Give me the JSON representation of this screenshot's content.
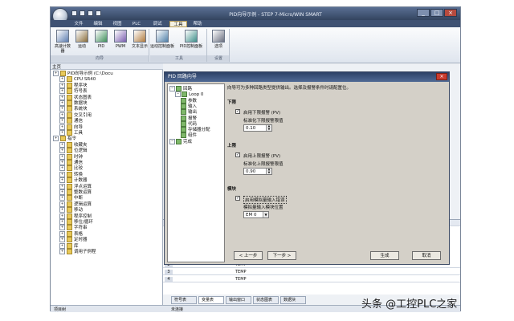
{
  "app": {
    "title": "PID向导示例 - STEP 7-Micro/WIN SMART",
    "menus": [
      "文件",
      "编辑",
      "视图",
      "PLC",
      "调试",
      "工具",
      "帮助"
    ],
    "active_menu": "工具",
    "ribbon_buttons": [
      "高速计数器",
      "运动",
      "PID",
      "PWM",
      "文本显示",
      "运动控制面板",
      "PID控制面板",
      "选项"
    ],
    "ribbon_groups": [
      "向导",
      "工具",
      "设置"
    ]
  },
  "tree": {
    "header": "主页",
    "items": [
      {
        "label": "PID向导示例 (C:\\Docu",
        "indent": 0,
        "icon": "project-icon"
      },
      {
        "label": "CPU SR40",
        "indent": 1,
        "icon": "cpu-icon"
      },
      {
        "label": "程序块",
        "indent": 1,
        "icon": "folder-icon"
      },
      {
        "label": "符号表",
        "indent": 1,
        "icon": "folder-icon"
      },
      {
        "label": "状态图表",
        "indent": 1,
        "icon": "folder-icon"
      },
      {
        "label": "数据块",
        "indent": 1,
        "icon": "folder-icon"
      },
      {
        "label": "系统块",
        "indent": 1,
        "icon": "folder-icon"
      },
      {
        "label": "交叉引用",
        "indent": 1,
        "icon": "folder-icon"
      },
      {
        "label": "通信",
        "indent": 1,
        "icon": "folder-icon"
      },
      {
        "label": "向导",
        "indent": 1,
        "icon": "folder-icon"
      },
      {
        "label": "工具",
        "indent": 1,
        "icon": "folder-icon"
      },
      {
        "label": "指令",
        "indent": 0,
        "icon": "folder-icon"
      },
      {
        "label": "收藏夹",
        "indent": 1,
        "icon": "folder-icon"
      },
      {
        "label": "位逻辑",
        "indent": 1,
        "icon": "folder-icon"
      },
      {
        "label": "时钟",
        "indent": 1,
        "icon": "folder-icon"
      },
      {
        "label": "通信",
        "indent": 1,
        "icon": "folder-icon"
      },
      {
        "label": "比较",
        "indent": 1,
        "icon": "folder-icon"
      },
      {
        "label": "转换",
        "indent": 1,
        "icon": "folder-icon"
      },
      {
        "label": "计数器",
        "indent": 1,
        "icon": "folder-icon"
      },
      {
        "label": "浮点运算",
        "indent": 1,
        "icon": "folder-icon"
      },
      {
        "label": "整数运算",
        "indent": 1,
        "icon": "folder-icon"
      },
      {
        "label": "中断",
        "indent": 1,
        "icon": "folder-icon"
      },
      {
        "label": "逻辑运算",
        "indent": 1,
        "icon": "folder-icon"
      },
      {
        "label": "移动",
        "indent": 1,
        "icon": "folder-icon"
      },
      {
        "label": "程序控制",
        "indent": 1,
        "icon": "folder-icon"
      },
      {
        "label": "移位/循环",
        "indent": 1,
        "icon": "folder-icon"
      },
      {
        "label": "字符串",
        "indent": 1,
        "icon": "folder-icon"
      },
      {
        "label": "表格",
        "indent": 1,
        "icon": "folder-icon"
      },
      {
        "label": "定时器",
        "indent": 1,
        "icon": "folder-icon"
      },
      {
        "label": "库",
        "indent": 1,
        "icon": "folder-icon"
      },
      {
        "label": "调用子例程",
        "indent": 1,
        "icon": "folder-icon"
      }
    ]
  },
  "sym_rows": [
    {
      "n": "2",
      "v": "TEMP"
    },
    {
      "n": "3",
      "v": "TEMP"
    },
    {
      "n": "4",
      "v": "TEMP"
    }
  ],
  "bottom_tabs": [
    "符号表",
    "变量表",
    "输出窗口",
    "状态图表",
    "数据块"
  ],
  "status": {
    "left": "项目树",
    "right": "未连接"
  },
  "dialog": {
    "title": "PID 回路向导",
    "description": "向导可为多种回路类型提供输出。选择及报警条件时请配置位。",
    "tree": [
      {
        "label": "回路",
        "indent": 0
      },
      {
        "label": "Loop 0",
        "indent": 1
      },
      {
        "label": "参数",
        "indent": 2
      },
      {
        "label": "输入",
        "indent": 2
      },
      {
        "label": "输出",
        "indent": 2
      },
      {
        "label": "报警",
        "indent": 2
      },
      {
        "label": "代码",
        "indent": 2
      },
      {
        "label": "存储器分配",
        "indent": 2
      },
      {
        "label": "组件",
        "indent": 2
      },
      {
        "label": "完成",
        "indent": 0
      }
    ],
    "low": {
      "section": "下限",
      "check_label": "启用下限报警 (PV)",
      "value_label": "标准化下限报警限值",
      "value": "0.10"
    },
    "high": {
      "section": "上限",
      "check_label": "启用上限报警 (PV)",
      "value_label": "标准化上限报警限值",
      "value": "0.90"
    },
    "module": {
      "section": "模块",
      "check_label": "启用模拟量输入错误",
      "value_label": "模拟量输入模块位置",
      "value": "EM 0"
    },
    "buttons": {
      "prev": "< 上一步",
      "next": "下一步 >",
      "finish": "生成",
      "cancel": "取消"
    }
  },
  "watermark": "头条 @工控PLC之家"
}
